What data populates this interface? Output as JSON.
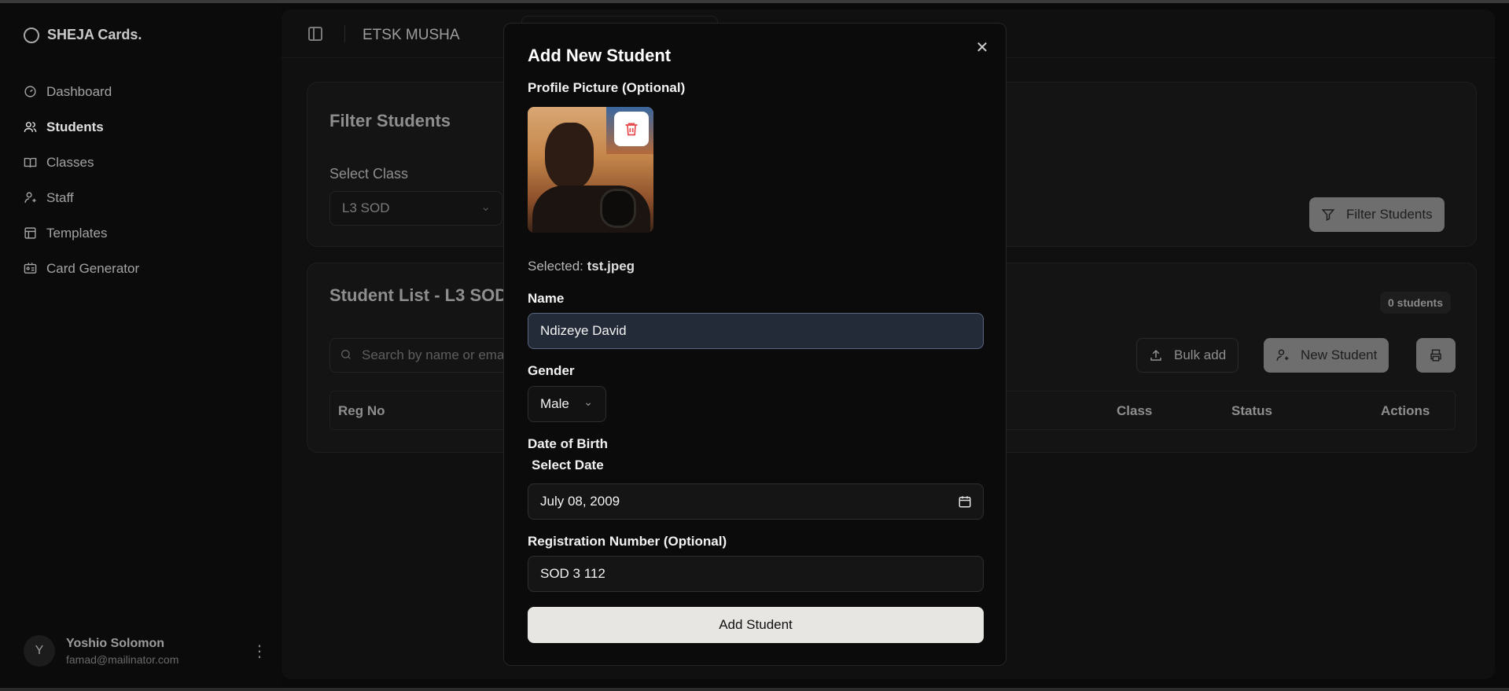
{
  "app": {
    "brand": "SHEJA Cards."
  },
  "sidebar": {
    "items": [
      {
        "label": "Dashboard",
        "icon": "dashboard-icon"
      },
      {
        "label": "Students",
        "icon": "users-icon",
        "active": true
      },
      {
        "label": "Classes",
        "icon": "book-icon"
      },
      {
        "label": "Staff",
        "icon": "user-plus-icon"
      },
      {
        "label": "Templates",
        "icon": "template-icon"
      },
      {
        "label": "Card Generator",
        "icon": "id-card-icon"
      }
    ],
    "user": {
      "initial": "Y",
      "name": "Yoshio Solomon",
      "email": "famad@mailinator.com"
    }
  },
  "header": {
    "title": "ETSK MUSHA"
  },
  "filter_card": {
    "title": "Filter Students",
    "select_label": "Select Class",
    "select_value": "L3 SOD",
    "button": "Filter Students"
  },
  "list_card": {
    "title": "Student List - L3 SOD",
    "count_badge": "0 students",
    "search_placeholder": "Search by name or ema",
    "bulk_add": "Bulk add",
    "new_student": "New Student",
    "columns": [
      "Reg No",
      "Class",
      "Status",
      "Actions"
    ]
  },
  "modal": {
    "title": "Add New Student",
    "profile_label": "Profile Picture (Optional)",
    "selected_prefix": "Selected:",
    "selected_file": "tst.jpeg",
    "name_label": "Name",
    "name_value": "Ndizeye David",
    "gender_label": "Gender",
    "gender_value": "Male",
    "dob_label": "Date of Birth",
    "dob_sublabel": "Select Date",
    "dob_value": "July 08, 2009",
    "reg_label": "Registration Number (Optional)",
    "reg_value": "SOD 3 112",
    "submit": "Add Student"
  },
  "colors": {
    "delete_icon": "#e5484d",
    "submit_bg": "#e8e6e3",
    "focus_input_bg": "#242b38"
  }
}
